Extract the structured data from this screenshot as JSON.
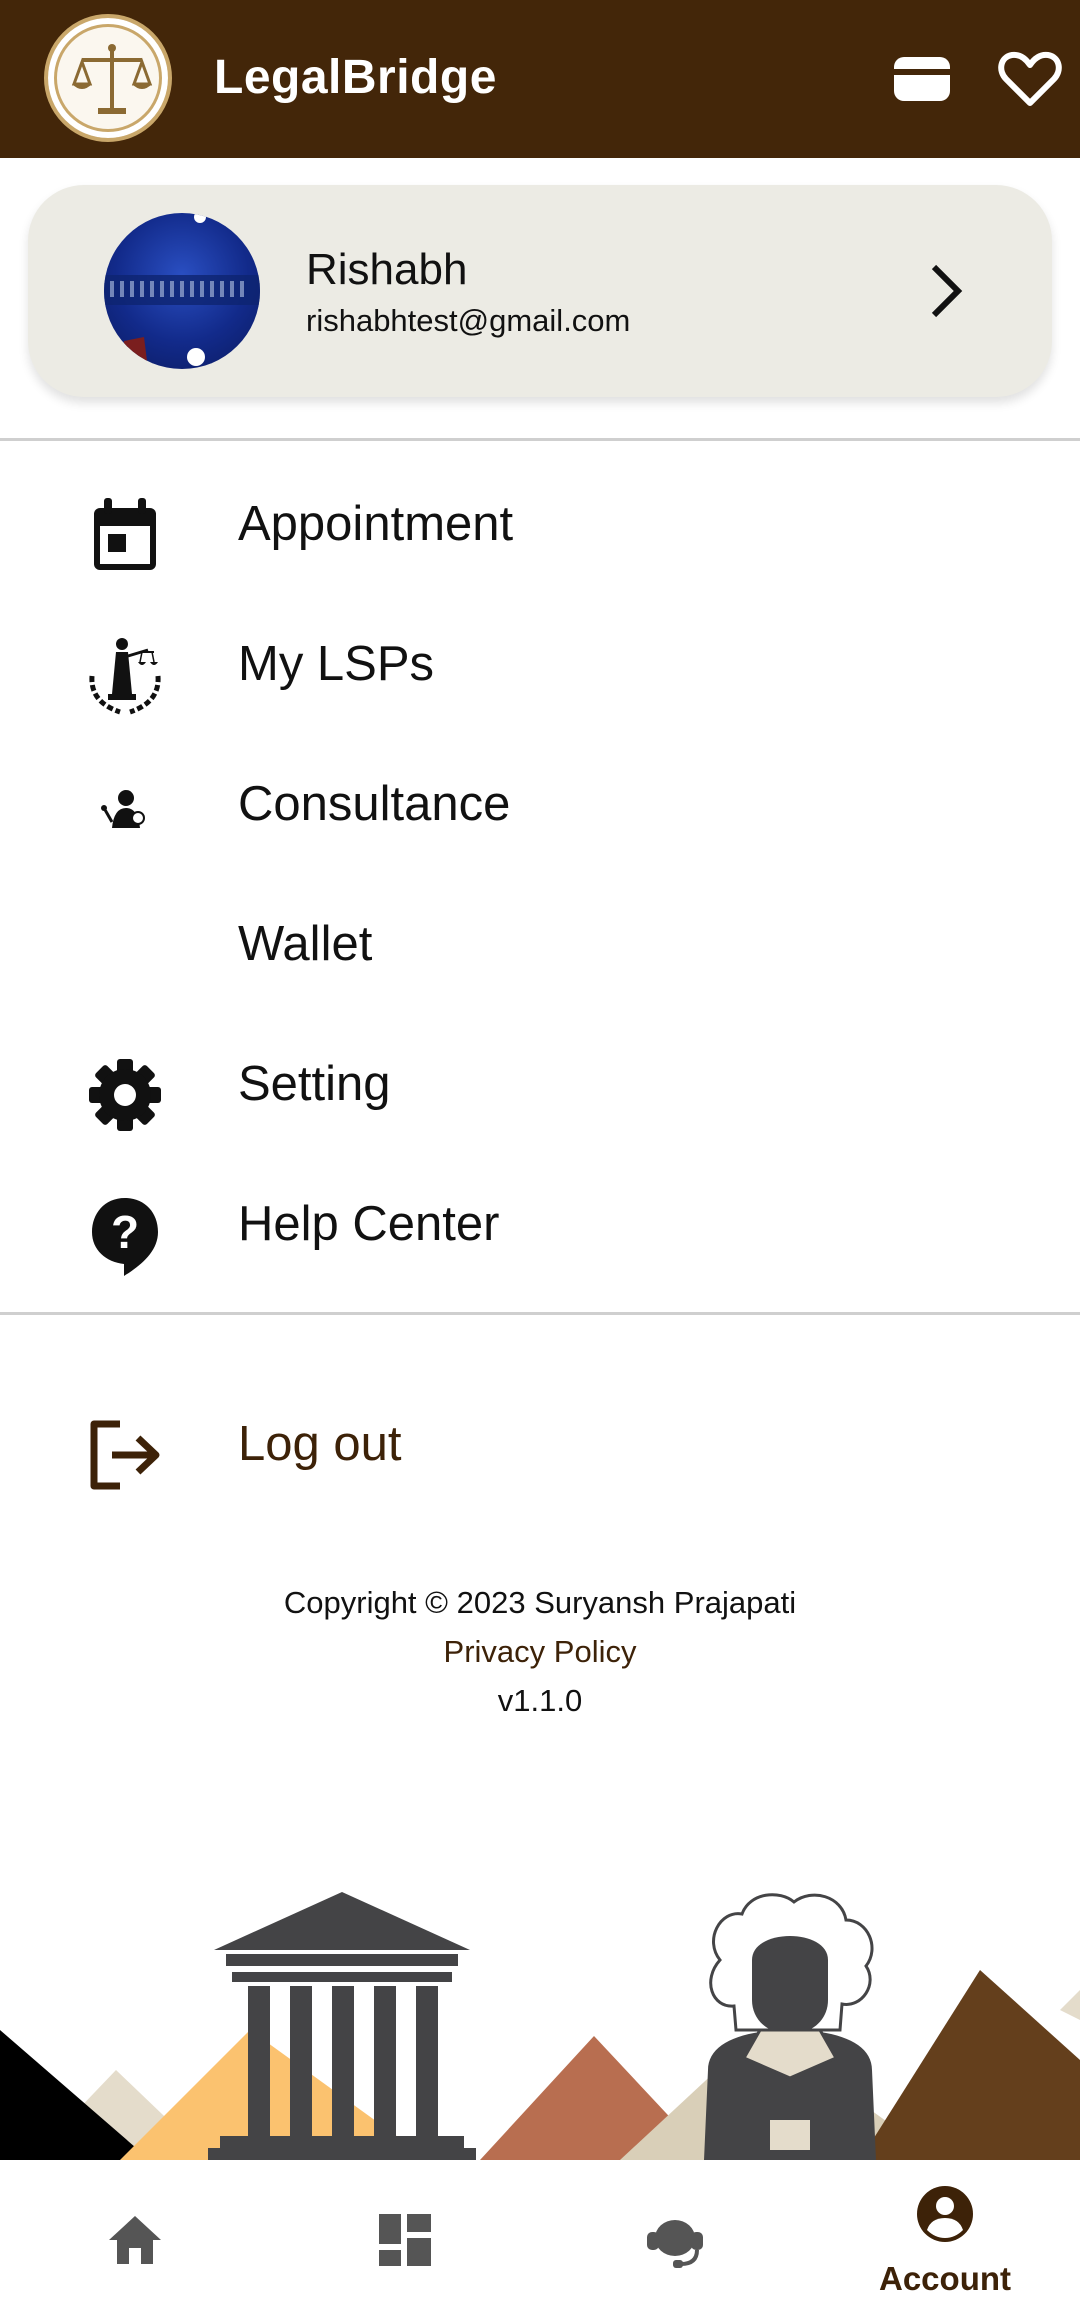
{
  "app": {
    "title": "LegalBridge"
  },
  "colors": {
    "primary": "#432609",
    "card_bg": "#ecebe4",
    "accent_text": "#3d2208"
  },
  "appbar": {
    "icons": [
      "wallet-icon",
      "heart-icon"
    ]
  },
  "profile": {
    "name": "Rishabh",
    "email": "rishabhtest@gmail.com"
  },
  "menu": {
    "items": [
      {
        "label": "Appointment",
        "icon": "calendar-icon"
      },
      {
        "label": "My LSPs",
        "icon": "justice-statue-icon"
      },
      {
        "label": "Consultance",
        "icon": "consultant-icon"
      },
      {
        "label": "Wallet",
        "icon": ""
      },
      {
        "label": "Setting",
        "icon": "gear-icon"
      },
      {
        "label": "Help Center",
        "icon": "help-icon"
      }
    ],
    "logout": {
      "label": "Log out",
      "icon": "logout-icon"
    }
  },
  "footer": {
    "copyright": "Copyright © 2023 Suryansh Prajapati",
    "privacy": "Privacy Policy",
    "version": "v1.1.0"
  },
  "bottom_nav": {
    "items": [
      {
        "icon": "home-icon",
        "label": ""
      },
      {
        "icon": "dashboard-icon",
        "label": ""
      },
      {
        "icon": "support-headset-icon",
        "label": ""
      },
      {
        "icon": "account-icon",
        "label": "Account",
        "active": true
      }
    ]
  }
}
